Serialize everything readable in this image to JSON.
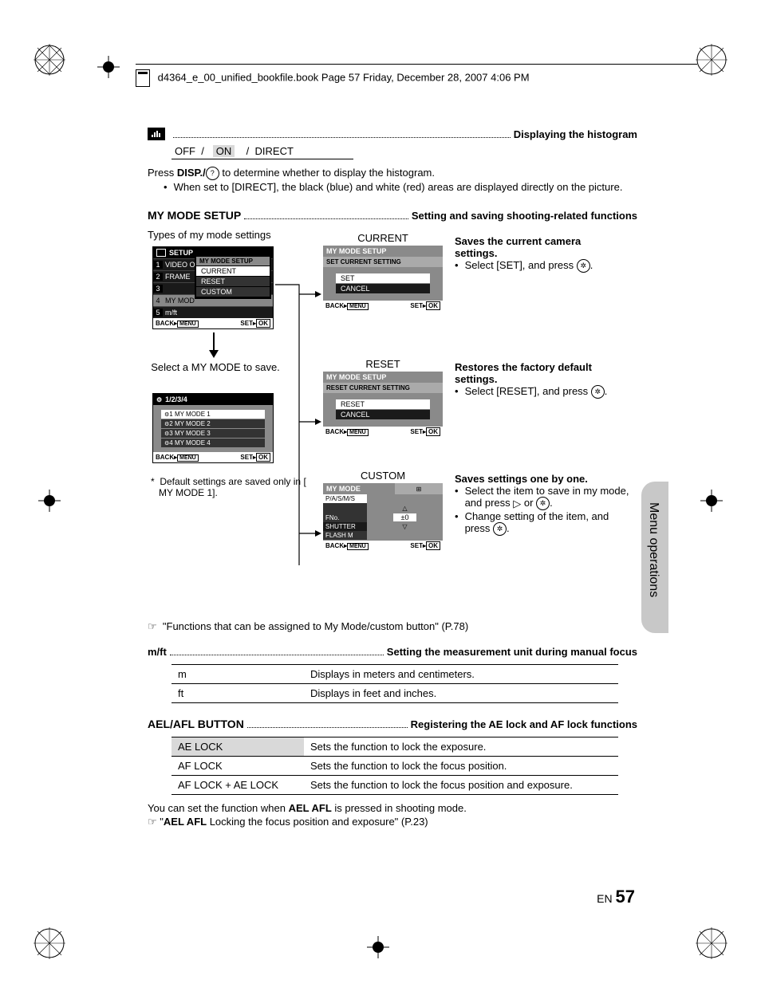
{
  "header": "d4364_e_00_unified_bookfile.book  Page 57  Friday, December 28, 2007  4:06 PM",
  "histogram": {
    "title_right": "Displaying the histogram",
    "options": {
      "off": "OFF",
      "sep1": "/",
      "on": "ON",
      "sep2": "/",
      "direct": "DIRECT"
    },
    "line1_pre": "Press ",
    "line1_disp": "DISP./",
    "line1_post": " to determine whether to display the histogram.",
    "bullet1": "When set to [DIRECT], the black (blue) and white (red) areas are displayed directly on the picture."
  },
  "mymode": {
    "title": "MY MODE SETUP",
    "title_right": "Setting and saving shooting-related functions",
    "types_label": "Types of my mode settings",
    "screen1": {
      "setup": "SETUP",
      "popup_title": "MY MODE SETUP",
      "rows": [
        "VIDEO O",
        "FRAME",
        "",
        "MY MOD",
        "m/ft"
      ],
      "pop_items": [
        "CURRENT",
        "RESET",
        "CUSTOM"
      ],
      "back": "BACK",
      "menu": "MENU",
      "set": "SET",
      "ok": "OK"
    },
    "select_label": "Select a MY MODE to save.",
    "screen2": {
      "title": "1/2/3/4",
      "items": [
        "1 MY MODE 1",
        "2 MY MODE 2",
        "3 MY MODE 3",
        "4 MY MODE 4"
      ],
      "back": "BACK",
      "menu": "MENU",
      "set": "SET",
      "ok": "OK"
    },
    "footnote": "Default settings are saved only in [      MY MODE 1].",
    "current": {
      "label": "CURRENT",
      "screen": {
        "t1": "MY MODE SETUP",
        "t2": "SET CURRENT SETTING",
        "opt1": "SET",
        "opt2": "CANCEL",
        "back": "BACK",
        "menu": "MENU",
        "set": "SET",
        "ok": "OK"
      },
      "heading": "Saves the current camera settings.",
      "bullet": "Select [SET], and press "
    },
    "reset": {
      "label": "RESET",
      "screen": {
        "t1": "MY MODE SETUP",
        "t2": "RESET CURRENT SETTING",
        "opt1": "RESET",
        "opt2": "CANCEL",
        "back": "BACK",
        "menu": "MENU",
        "set": "SET",
        "ok": "OK"
      },
      "heading": "Restores the factory default settings.",
      "bullet": "Select [RESET], and press "
    },
    "custom": {
      "label": "CUSTOM",
      "screen": {
        "t1": "MY MODE",
        "rows": [
          "P/A/S/M/S",
          "",
          "FNo.",
          "SHUTTER",
          "FLASH M"
        ],
        "val": "±0",
        "back": "BACK",
        "menu": "MENU",
        "set": "SET",
        "ok": "OK"
      },
      "heading": "Saves settings one by one.",
      "b1_pre": "Select the item to save in my mode, and press ",
      "b1_mid": " or ",
      "b2_pre": "Change setting of the item, and press "
    },
    "ref": "\"Functions that can be assigned to My Mode/custom button\" (P.78)"
  },
  "mft": {
    "title": "m/ft",
    "title_right": "Setting the measurement unit during manual focus",
    "rows": [
      {
        "k": "m",
        "v": "Displays in meters and centimeters."
      },
      {
        "k": "ft",
        "v": "Displays in feet and inches."
      }
    ]
  },
  "ael": {
    "title": "AEL/AFL BUTTON",
    "title_right": "Registering the AE lock and AF lock functions",
    "rows": [
      {
        "k": "AE LOCK",
        "v": "Sets the function to lock the exposure."
      },
      {
        "k": "AF LOCK",
        "v": "Sets the function to lock the focus position."
      },
      {
        "k": "AF LOCK + AE LOCK",
        "v": "Sets the function to lock the focus position and exposure."
      }
    ],
    "line1_pre": "You can set the function when ",
    "line1_b": "AEL AFL",
    "line1_post": " is pressed in shooting mode.",
    "ref_pre": "\"",
    "ref_b": "AEL AFL",
    "ref_post": " Locking the focus position and exposure\" (P.23)"
  },
  "side_text": "Menu operations",
  "page_num": {
    "en": "EN",
    "num": "57"
  }
}
